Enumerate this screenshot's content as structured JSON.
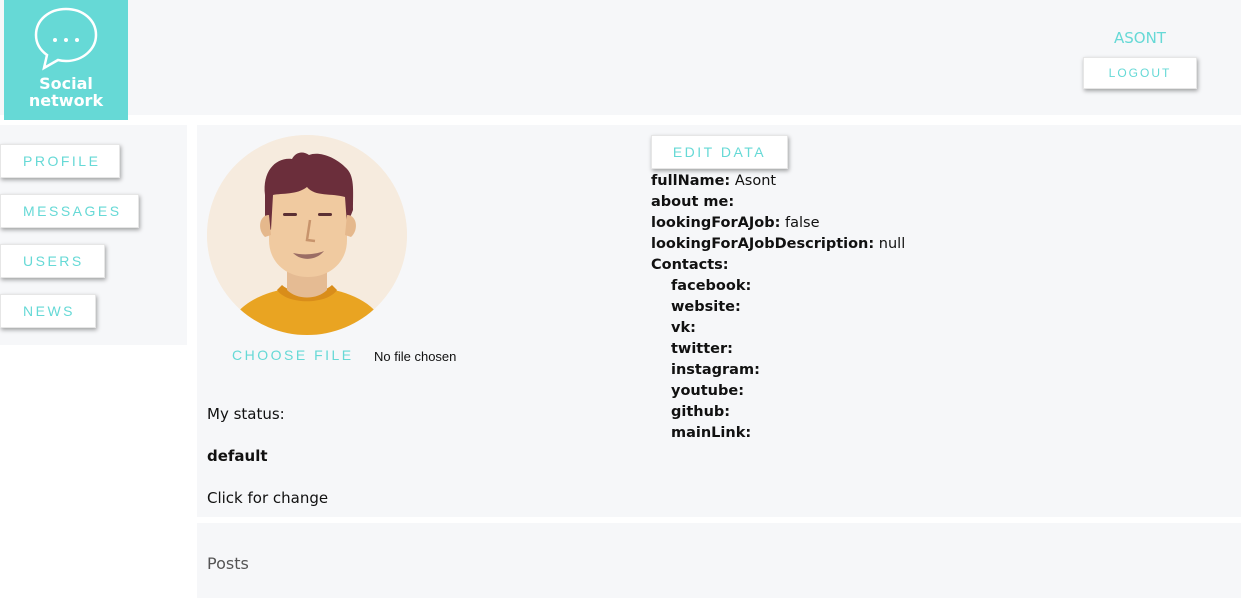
{
  "header": {
    "logo_line1": "Social",
    "logo_line2": "network",
    "logo_icon": "chat-bubble-icon",
    "login": "ASONT",
    "logout_label": "LOGOUT"
  },
  "sidebar": {
    "items": [
      {
        "label": "PROFILE"
      },
      {
        "label": "MESSAGES"
      },
      {
        "label": "USERS"
      },
      {
        "label": "NEWS"
      }
    ]
  },
  "profile": {
    "avatar_icon": "user-avatar-icon",
    "choose_file_label": "CHOOSE FILE",
    "no_file_text": "No file chosen",
    "status_label": "My status:",
    "status_value": "default",
    "status_hint": "Click for change",
    "edit_label": "EDIT DATA",
    "fields": [
      {
        "key": "fullName:",
        "value": "Asont"
      },
      {
        "key": "about me:",
        "value": ""
      },
      {
        "key": "lookingForAJob:",
        "value": "false"
      },
      {
        "key": "lookingForAJobDescription:",
        "value": "null"
      },
      {
        "key": "Contacts:",
        "value": ""
      }
    ],
    "contacts": [
      {
        "key": "facebook:"
      },
      {
        "key": "website:"
      },
      {
        "key": "vk:"
      },
      {
        "key": "twitter:"
      },
      {
        "key": "instagram:"
      },
      {
        "key": "youtube:"
      },
      {
        "key": "github:"
      },
      {
        "key": "mainLink:"
      }
    ]
  },
  "posts": {
    "title": "Posts"
  },
  "colors": {
    "accent": "#66d9d6",
    "panel": "#f6f7f9"
  }
}
